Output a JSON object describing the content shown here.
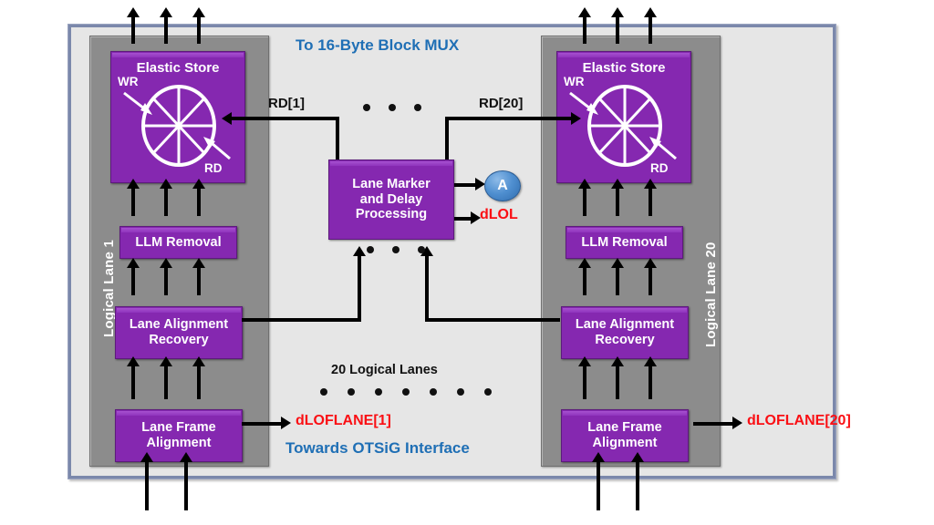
{
  "diagram": {
    "top_label": "To 16-Byte Block MUX",
    "bottom_label": "Towards OTSiG Interface",
    "center_label": "20 Logical Lanes"
  },
  "colors": {
    "block_purple": "#8528b0",
    "lane_gray": "#8c8c8c",
    "canvas_gray": "#e6e6e6",
    "accent_blue": "#1f6fb5",
    "alarm_red": "#fa0f14",
    "node_blue": "#4f8fd0"
  },
  "lanes": [
    {
      "id": "left",
      "vlabel": "Logical Lane 1",
      "rd_label": "RD[1]",
      "dlof_label": "dLOFLANE[1]",
      "blocks": [
        {
          "title": "Elastic Store",
          "wr": "WR",
          "rd": "RD"
        },
        {
          "title": "LLM Removal"
        },
        {
          "title": "Lane Alignment",
          "title2": "Recovery"
        },
        {
          "title": "Lane Frame",
          "title2": "Alignment"
        }
      ]
    },
    {
      "id": "right",
      "vlabel": "Logical Lane 20",
      "rd_label": "RD[20]",
      "dlof_label": "dLOFLANE[20]",
      "blocks": [
        {
          "title": "Elastic Store",
          "wr": "WR",
          "rd": "RD"
        },
        {
          "title": "LLM Removal"
        },
        {
          "title": "Lane Alignment",
          "title2": "Recovery"
        },
        {
          "title": "Lane Frame",
          "title2": "Alignment"
        }
      ]
    }
  ],
  "center": {
    "marker_line1": "Lane Marker",
    "marker_line2": "and Delay",
    "marker_line3": "Processing",
    "a_node_label": "A",
    "dlol_label": "dLOL"
  }
}
